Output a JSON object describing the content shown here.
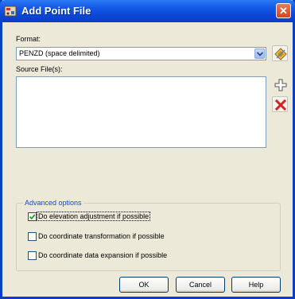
{
  "window": {
    "title": "Add Point File",
    "close_glyph": "✕"
  },
  "format": {
    "label": "Format:",
    "selected": "PENZD (space delimited)"
  },
  "source": {
    "label": "Source File(s):",
    "files": []
  },
  "advanced": {
    "title": "Advanced options",
    "options": [
      {
        "label": "Do elevation adjustment if possible",
        "checked": true
      },
      {
        "label": "Do coordinate transformation if possible",
        "checked": false
      },
      {
        "label": "Do coordinate data expansion if possible",
        "checked": false
      }
    ]
  },
  "buttons": {
    "ok": "OK",
    "cancel": "Cancel",
    "help": "Help"
  },
  "icons": {
    "app": "point-file-icon",
    "format_edit": "diamond-edit-icon",
    "add": "plus-icon",
    "remove": "red-x-icon",
    "dropdown": "chevron-down-icon"
  },
  "colors": {
    "titlebar": "#0a46d6",
    "remove_red": "#d22222",
    "group_title": "#1f46c8"
  }
}
